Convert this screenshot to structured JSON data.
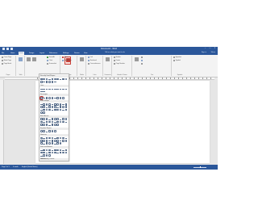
{
  "window": {
    "title": "Document1 - Word"
  },
  "tabs": [
    "File",
    "Home",
    "Insert",
    "Design",
    "Layout",
    "References",
    "Mailings",
    "Review",
    "View",
    "Tell me what you want to do"
  ],
  "active_tab": "Insert",
  "account": {
    "sign_in": "Sign in",
    "share": "Share"
  },
  "ribbon": {
    "pages": {
      "items": [
        "Cover Page",
        "Blank Page",
        "Page Break"
      ],
      "label": "Pages"
    },
    "tables": {
      "label": "Table"
    },
    "illustrations": {
      "pictures": "Pictures",
      "online_pictures": "Online Pictures",
      "shapes": "Shapes",
      "smartart": "SmartArt",
      "chart": "Chart",
      "screenshot": "Screenshot",
      "label": "Illustrations"
    },
    "addins": {
      "store": "Store",
      "my_addins": "My Add-ins",
      "label": "Add-ins"
    },
    "media": {
      "online_video": "Online Video",
      "label": "Media"
    },
    "links": {
      "link": "Link",
      "bookmark": "Bookmark",
      "cross_reference": "Cross-reference",
      "label": "Links"
    },
    "comments": {
      "comment": "Comment",
      "label": "Comments"
    },
    "header_footer": {
      "header": "Header",
      "footer": "Footer",
      "page_number": "Page Number",
      "label": "Header & Footer"
    },
    "text": {
      "text_box": "Text Box",
      "label": "Text"
    },
    "symbols": {
      "equation": "Equation",
      "symbol": "Symbol",
      "label": "Symbols"
    }
  },
  "shapes_menu": {
    "sections": [
      {
        "title": "Recently Used Shapes",
        "count": 16
      },
      {
        "title": "Lines",
        "count": 12
      },
      {
        "title": "Rectangles",
        "count": 9
      },
      {
        "title": "Basic Shapes",
        "count": 32
      },
      {
        "title": "Block Arrows",
        "count": 27
      },
      {
        "title": "Equation Shapes",
        "count": 6
      },
      {
        "title": "Flowchart",
        "count": 28
      },
      {
        "title": "Stars and Banners",
        "count": 24
      },
      {
        "title": "Callouts",
        "count": 16
      }
    ],
    "footer": "New Drawing Canvas"
  },
  "status": {
    "page": "Page 1 of 1",
    "words": "0 words",
    "language": "English (United States)"
  }
}
